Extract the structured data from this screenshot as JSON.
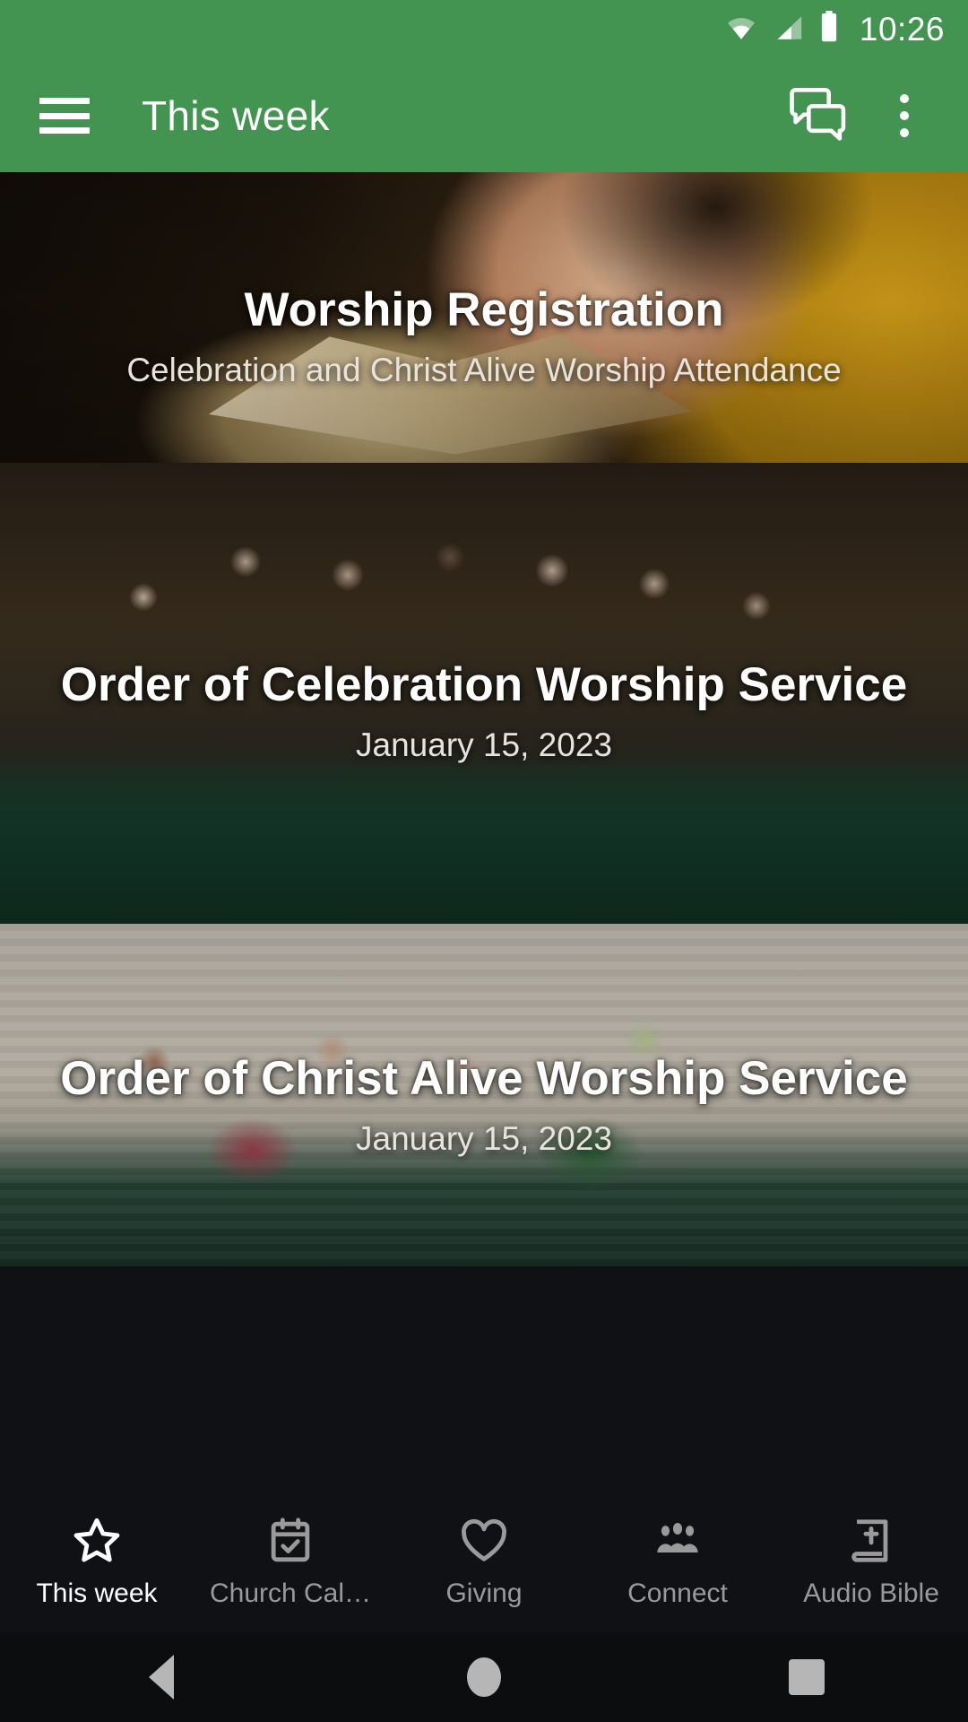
{
  "status_bar": {
    "time": "10:26",
    "icons": [
      "wifi-icon",
      "cellular-signal-icon",
      "battery-icon"
    ]
  },
  "app_bar": {
    "menu_icon": "hamburger-menu-icon",
    "title": "This week",
    "actions": [
      {
        "icon": "chat-bubbles-icon",
        "name": "messages-button"
      },
      {
        "icon": "overflow-menu-icon",
        "name": "more-options-button"
      }
    ],
    "background_color": "#449451",
    "text_color": "#ffffff"
  },
  "feed": {
    "cards": [
      {
        "title": "Worship Registration",
        "subtitle": "Celebration and Christ Alive Worship Attendance",
        "image": "hands-holding-open-bible"
      },
      {
        "title": "Order of Celebration Worship Service",
        "subtitle": "January 15, 2023",
        "image": "choir-singing-in-sanctuary"
      },
      {
        "title": "Order of Christ Alive Worship Service",
        "subtitle": "January 15, 2023",
        "image": "praise-band-worship-team"
      }
    ]
  },
  "bottom_nav": {
    "active_index": 0,
    "items": [
      {
        "label": "This week",
        "icon": "star-icon"
      },
      {
        "label": "Church Cal…",
        "icon": "calendar-check-icon"
      },
      {
        "label": "Giving",
        "icon": "heart-icon"
      },
      {
        "label": "Connect",
        "icon": "people-group-icon"
      },
      {
        "label": "Audio Bible",
        "icon": "bible-book-icon"
      }
    ],
    "active_color": "#ffffff",
    "inactive_color": "#9a9a9a",
    "background_color": "#101114"
  },
  "system_nav": {
    "buttons": [
      {
        "name": "back-button",
        "icon": "triangle-back-icon"
      },
      {
        "name": "home-button",
        "icon": "circle-home-icon"
      },
      {
        "name": "recents-button",
        "icon": "square-recents-icon"
      }
    ]
  }
}
